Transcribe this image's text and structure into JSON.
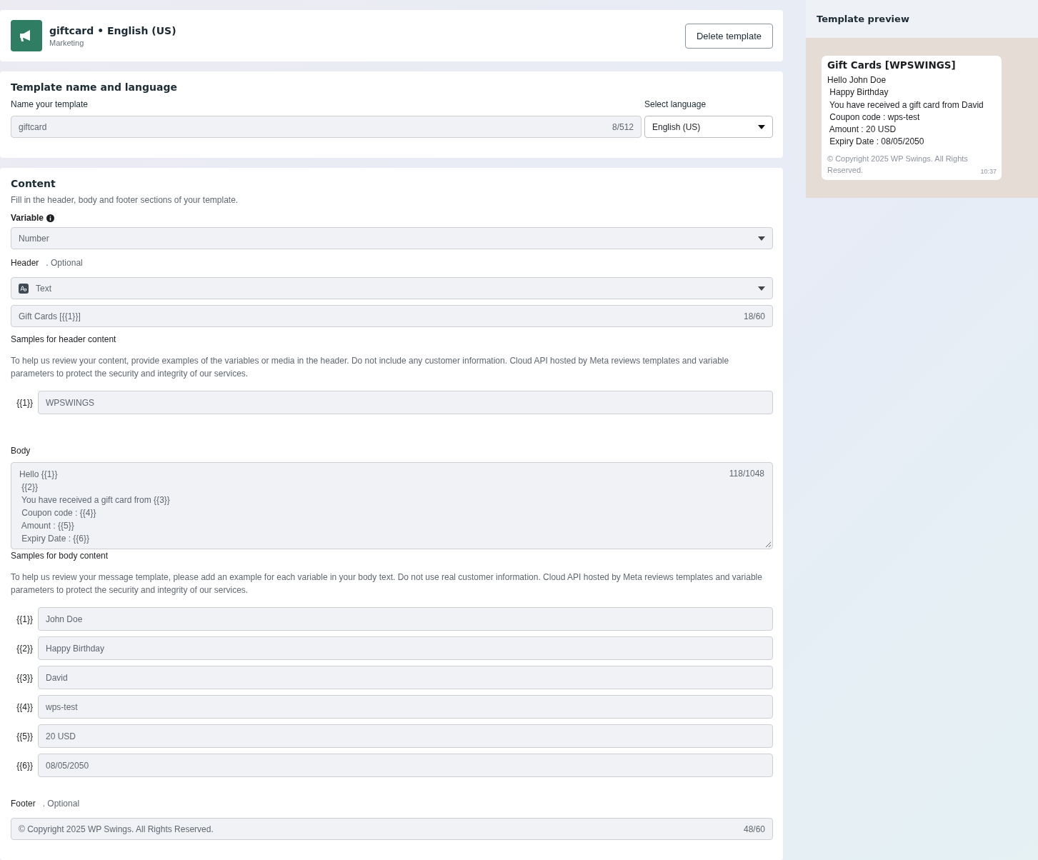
{
  "template_header": {
    "title": "giftcard • English (US)",
    "category": "Marketing",
    "delete_button": "Delete template"
  },
  "name_section": {
    "title": "Template name and language",
    "name_label": "Name your template",
    "name_value": "giftcard",
    "name_count": "8/512",
    "language_label": "Select language",
    "language_value": "English (US)"
  },
  "content": {
    "title": "Content",
    "subtitle": "Fill in the header, body and footer sections of your template.",
    "variable_label": "Variable",
    "variable_value": "Number",
    "header_label": "Header",
    "header_optional": ". Optional",
    "header_type": "Text",
    "header_value": "Gift Cards [{{1}}]",
    "header_count": "18/60",
    "header_samples_title": "Samples for header content",
    "header_samples_help": "To help us review your content, provide examples of the variables or media in the header. Do not include any customer information. Cloud API hosted by Meta reviews templates and variable parameters to protect the security and integrity of our services.",
    "header_samples": [
      {
        "variable": "{{1}}",
        "value": "WPSWINGS"
      }
    ],
    "body_label": "Body",
    "body_lines": [
      "Hello {{1}}",
      " {{2}}",
      " You have received a gift card from {{3}}",
      " Coupon code : {{4}}",
      " Amount : {{5}}",
      " Expiry Date : {{6}}"
    ],
    "body_count": "118/1048",
    "body_samples_title": "Samples for body content",
    "body_samples_help": "To help us review your message template, please add an example for each variable in your body text. Do not use real customer information. Cloud API hosted by Meta reviews templates and variable parameters to protect the security and integrity of our services.",
    "body_samples": [
      {
        "variable": "{{1}}",
        "value": "John Doe"
      },
      {
        "variable": "{{2}}",
        "value": "Happy Birthday"
      },
      {
        "variable": "{{3}}",
        "value": "David"
      },
      {
        "variable": "{{4}}",
        "value": "wps-test"
      },
      {
        "variable": "{{5}}",
        "value": "20 USD"
      },
      {
        "variable": "{{6}}",
        "value": "08/05/2050"
      }
    ],
    "footer_label": "Footer",
    "footer_optional": ". Optional",
    "footer_value": "© Copyright 2025 WP Swings. All Rights Reserved.",
    "footer_count": "48/60"
  },
  "preview": {
    "title": "Template preview",
    "message_header": "Gift Cards [WPSWINGS]",
    "message_lines": [
      "Hello John Doe",
      " Happy Birthday",
      " You have received a gift card from David",
      " Coupon code : wps-test",
      " Amount : 20 USD",
      " Expiry Date : 08/05/2050"
    ],
    "message_footer": "© Copyright 2025 WP Swings. All Rights Reserved.",
    "time": "10:37"
  }
}
